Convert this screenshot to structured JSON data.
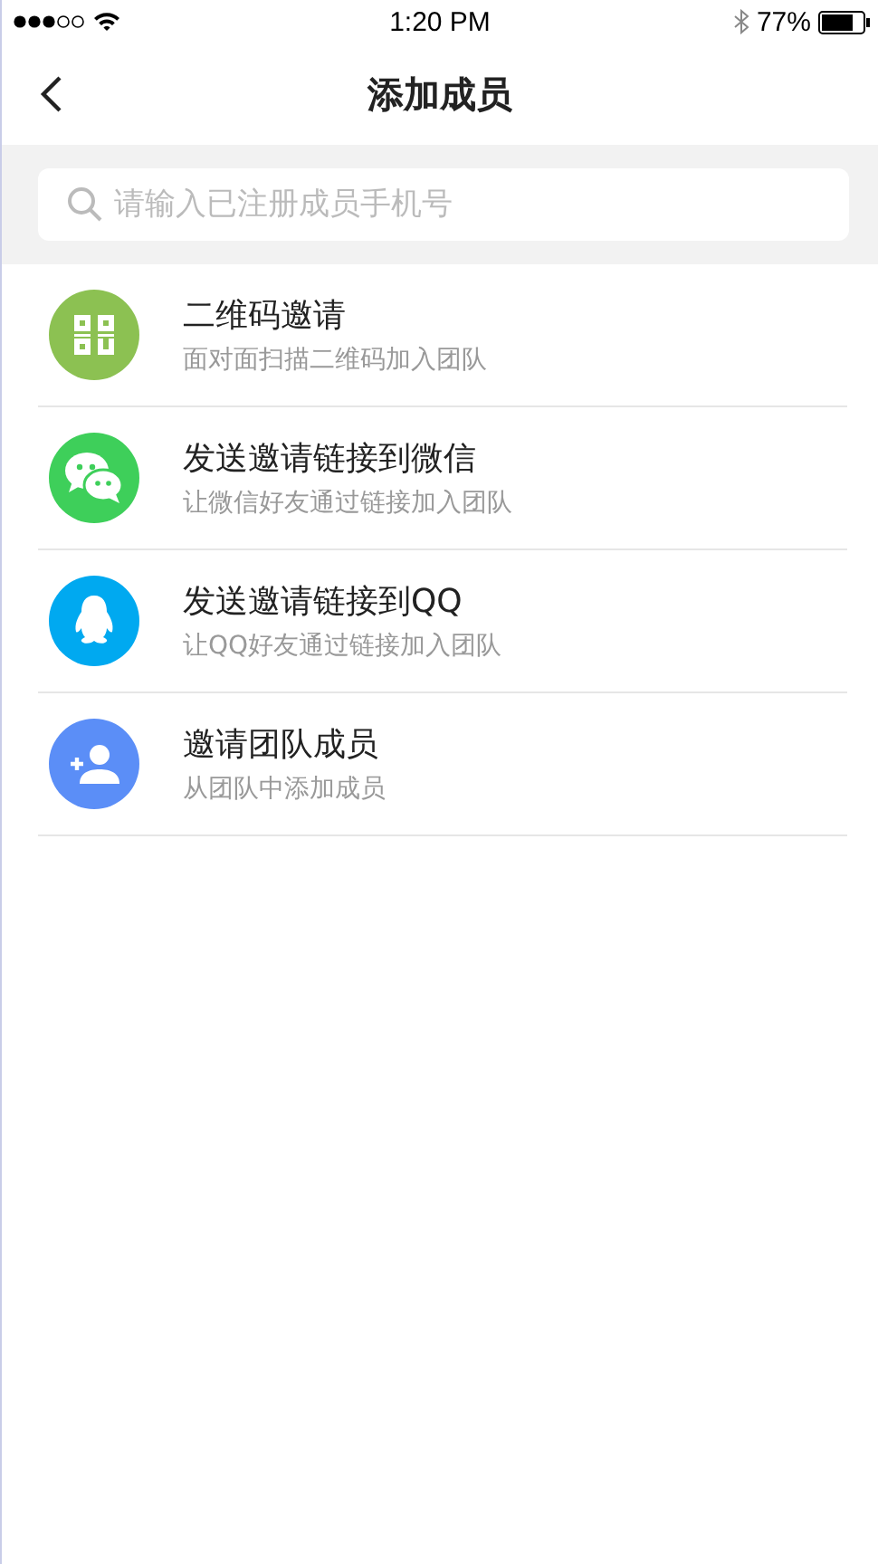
{
  "status_bar": {
    "time": "1:20 PM",
    "battery": "77%"
  },
  "nav": {
    "title": "添加成员"
  },
  "search": {
    "placeholder": "请输入已注册成员手机号"
  },
  "items": [
    {
      "kind": "qr",
      "color": "#8cc152",
      "title": "二维码邀请",
      "subtitle": "面对面扫描二维码加入团队"
    },
    {
      "kind": "wechat",
      "color": "#3ecf5a",
      "title": "发送邀请链接到微信",
      "subtitle": "让微信好友通过链接加入团队"
    },
    {
      "kind": "qq",
      "color": "#00a9f0",
      "title": "发送邀请链接到QQ",
      "subtitle": "让QQ好友通过链接加入团队"
    },
    {
      "kind": "add-user",
      "color": "#5b8ef7",
      "title": "邀请团队成员",
      "subtitle": "从团队中添加成员"
    }
  ]
}
